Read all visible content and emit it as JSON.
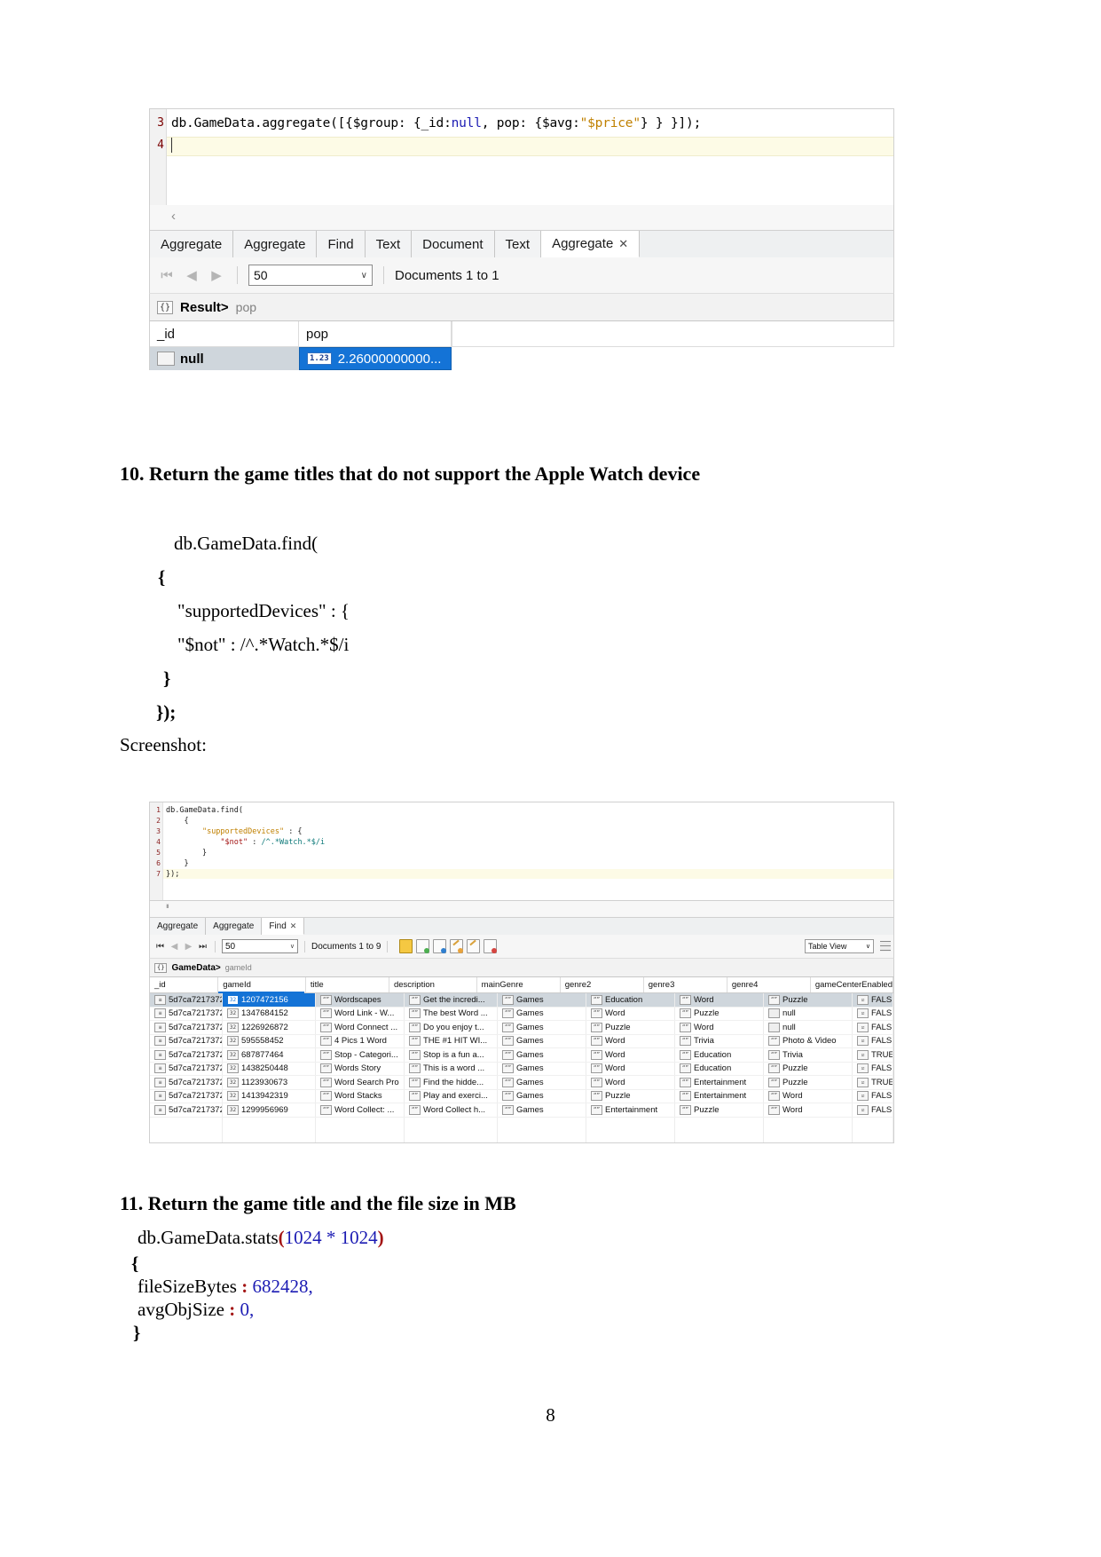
{
  "page": {
    "number": "8"
  },
  "screenshot1": {
    "editor": {
      "lines": [
        {
          "no": "3",
          "segments": [
            {
              "t": "db.GameData.aggregate([{$group: {_id:",
              "c": "plain"
            },
            {
              "t": "null",
              "c": "k-blue"
            },
            {
              "t": ", pop: {$avg:",
              "c": "plain"
            },
            {
              "t": "\"$price\"",
              "c": "k-orange"
            },
            {
              "t": "} } }]);",
              "c": "plain"
            }
          ]
        },
        {
          "no": "4",
          "segments": []
        }
      ]
    },
    "tabs": [
      {
        "label": "Aggregate",
        "active": false,
        "closable": false
      },
      {
        "label": "Aggregate",
        "active": false,
        "closable": false
      },
      {
        "label": "Find",
        "active": false,
        "closable": false
      },
      {
        "label": "Text",
        "active": false,
        "closable": false
      },
      {
        "label": "Document",
        "active": false,
        "closable": false
      },
      {
        "label": "Text",
        "active": false,
        "closable": false
      },
      {
        "label": "Aggregate",
        "active": true,
        "closable": true
      }
    ],
    "toolbar": {
      "page_size": "50",
      "documents_label": "Documents 1 to 1",
      "close_glyph": "✕"
    },
    "result_bar": {
      "chip": "{}",
      "label": "Result>",
      "field": "pop"
    },
    "grid": {
      "headers": [
        "_id",
        "pop"
      ],
      "rows": [
        {
          "_id": "null",
          "pop": "2.26000000000...",
          "pop_type": "1.23"
        }
      ]
    }
  },
  "question10": {
    "heading": "10. Return the game titles that do not support the Apple Watch device",
    "code": [
      "db.GameData.find(",
      "{",
      "\"supportedDevices\" : {",
      "\"$not\" : /^.*Watch.*$/i",
      "}",
      "});"
    ],
    "screenshot_label": "Screenshot:"
  },
  "screenshot2": {
    "editor": {
      "lines": [
        {
          "no": "1",
          "text": "db.GameData.find("
        },
        {
          "no": "2",
          "text": "    {"
        },
        {
          "no": "3",
          "text": "        \"supportedDevices\" : {"
        },
        {
          "no": "4",
          "text": "            \"$not\" : /^.*Watch.*$/i"
        },
        {
          "no": "5",
          "text": "        }"
        },
        {
          "no": "6",
          "text": "    }"
        },
        {
          "no": "7",
          "text": "});"
        }
      ]
    },
    "tabs": [
      {
        "label": "Aggregate",
        "active": false,
        "closable": false
      },
      {
        "label": "Aggregate",
        "active": false,
        "closable": false
      },
      {
        "label": "Find",
        "active": true,
        "closable": true
      }
    ],
    "toolbar": {
      "page_size": "50",
      "documents_label": "Documents 1 to 9",
      "view_mode": "Table View",
      "icons": [
        "lock-icon",
        "add-document-icon",
        "view-json-icon",
        "edit-document-icon",
        "clone-document-icon",
        "delete-document-icon"
      ]
    },
    "result_bar": {
      "chip": "{}",
      "label": "GameData>",
      "field": "gameId"
    },
    "table": {
      "headers": [
        "_id",
        "gameId",
        "title",
        "description",
        "mainGenre",
        "genre2",
        "genre3",
        "genre4",
        "gameCenterEnabled"
      ],
      "sorted_column": "gameId",
      "rows": [
        {
          "_id": "5d7ca7217372...",
          "gameId": "1207472156",
          "title": "Wordscapes",
          "description": "Get the incredi...",
          "mainGenre": "Games",
          "genre2": "Education",
          "genre3": "Word",
          "genre4": "Puzzle",
          "gameCenterEnabled": "FALSE",
          "selected": true
        },
        {
          "_id": "5d7ca7217372...",
          "gameId": "1347684152",
          "title": "Word Link - W...",
          "description": "The best Word ...",
          "mainGenre": "Games",
          "genre2": "Word",
          "genre3": "Puzzle",
          "genre4": "null",
          "gameCenterEnabled": "FALSE",
          "selected": false
        },
        {
          "_id": "5d7ca7217372...",
          "gameId": "1226926872",
          "title": "Word Connect ...",
          "description": "Do you enjoy t...",
          "mainGenre": "Games",
          "genre2": "Puzzle",
          "genre3": "Word",
          "genre4": "null",
          "gameCenterEnabled": "FALSE",
          "selected": false
        },
        {
          "_id": "5d7ca7217372...",
          "gameId": "595558452",
          "title": "4 Pics 1 Word",
          "description": "THE #1 HIT WI...",
          "mainGenre": "Games",
          "genre2": "Word",
          "genre3": "Trivia",
          "genre4": "Photo & Video",
          "gameCenterEnabled": "FALSE",
          "selected": false
        },
        {
          "_id": "5d7ca7217372...",
          "gameId": "687877464",
          "title": "Stop - Categori...",
          "description": "Stop is a fun a...",
          "mainGenre": "Games",
          "genre2": "Word",
          "genre3": "Education",
          "genre4": "Trivia",
          "gameCenterEnabled": "TRUE",
          "selected": false
        },
        {
          "_id": "5d7ca7217372...",
          "gameId": "1438250448",
          "title": "Words Story",
          "description": "This is a word ...",
          "mainGenre": "Games",
          "genre2": "Word",
          "genre3": "Education",
          "genre4": "Puzzle",
          "gameCenterEnabled": "FALSE",
          "selected": false
        },
        {
          "_id": "5d7ca7217372...",
          "gameId": "1123930673",
          "title": "Word Search Pro",
          "description": "Find the hidde...",
          "mainGenre": "Games",
          "genre2": "Word",
          "genre3": "Entertainment",
          "genre4": "Puzzle",
          "gameCenterEnabled": "TRUE",
          "selected": false
        },
        {
          "_id": "5d7ca7217372...",
          "gameId": "1413942319",
          "title": "Word Stacks",
          "description": "Play and exerci...",
          "mainGenre": "Games",
          "genre2": "Puzzle",
          "genre3": "Entertainment",
          "genre4": "Word",
          "gameCenterEnabled": "FALSE",
          "selected": false
        },
        {
          "_id": "5d7ca7217372...",
          "gameId": "1299956969",
          "title": "Word Collect: ...",
          "description": "Word Collect h...",
          "mainGenre": "Games",
          "genre2": "Entertainment",
          "genre3": "Puzzle",
          "genre4": "Word",
          "gameCenterEnabled": "FALSE",
          "selected": false
        }
      ]
    }
  },
  "question11": {
    "heading": "11. Return the game title and the file size in MB",
    "line1_a": "db.GameData.stats",
    "line1_b": "(",
    "line1_c": "1024 * 1024",
    "line1_d": ")",
    "line2": "{",
    "line3_key": "fileSizeBytes",
    "line3_colon": " : ",
    "line3_val": "682428,",
    "line4_key": "avgObjSize",
    "line4_colon": " : ",
    "line4_val": "0,",
    "line5": "}"
  },
  "colors": {
    "accent_blue": "#1473d6",
    "selection_gray": "#cfd6dc",
    "string_orange": "#c08000",
    "keyword_blue": "#1b1bb3",
    "code_red": "#a31515",
    "number_blue": "#2f6fc0"
  }
}
